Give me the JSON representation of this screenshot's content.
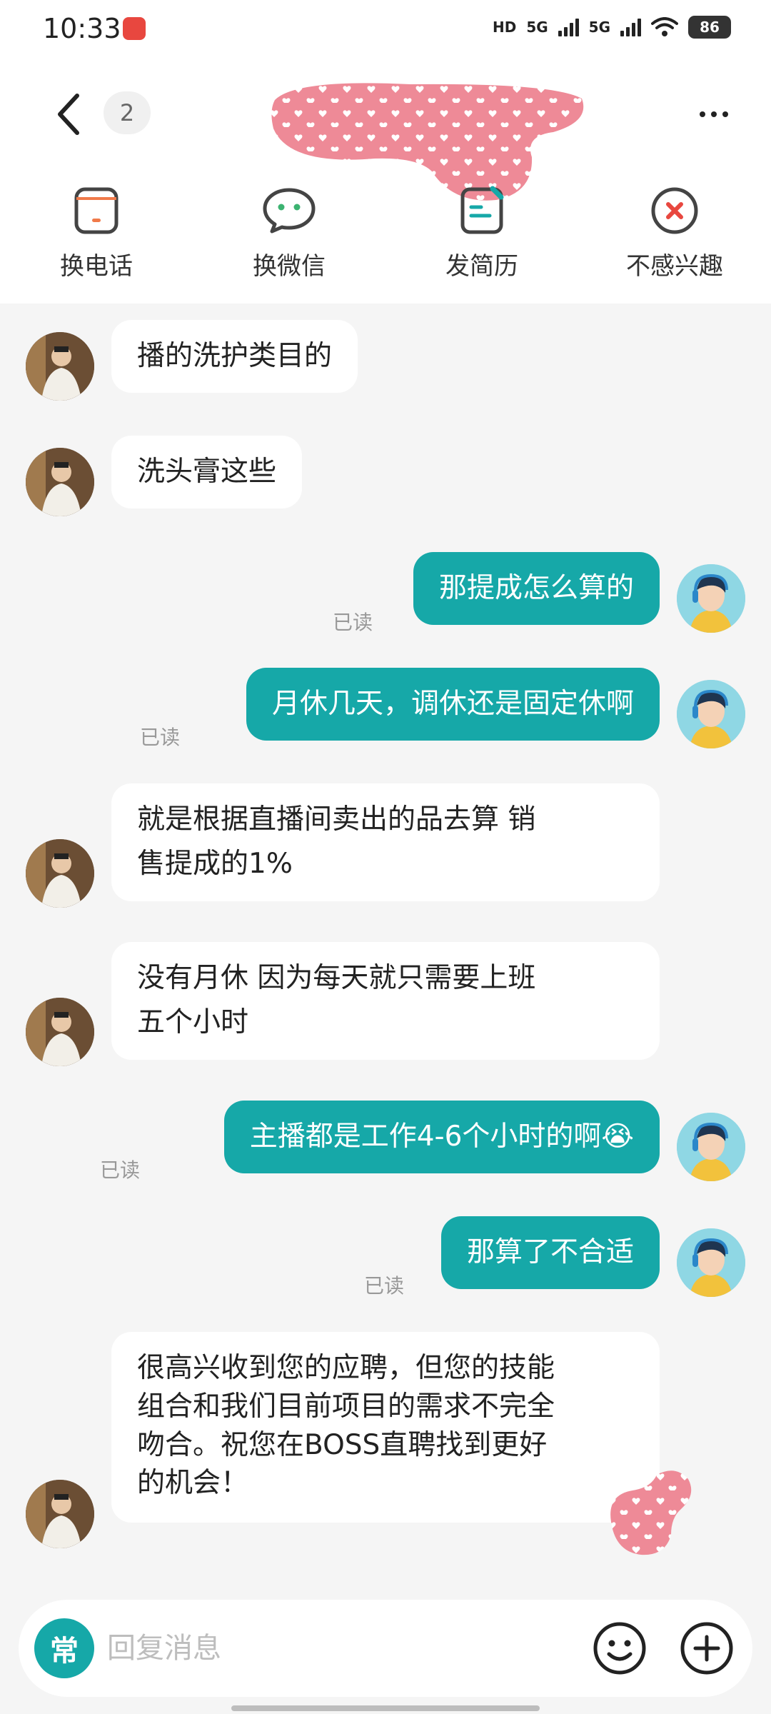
{
  "status_bar": {
    "time": "10:33",
    "hd_label": "HD",
    "net1": "5G",
    "net2": "5G",
    "battery": "86"
  },
  "header": {
    "unread_count": "2",
    "icons": {
      "back": "chevron-left-icon",
      "more": "more-horizontal-icon"
    }
  },
  "actions": [
    {
      "label": "换电话",
      "icon": "phone-icon",
      "color": "#f07a4a"
    },
    {
      "label": "换微信",
      "icon": "wechat-icon",
      "color": "#3cb371"
    },
    {
      "label": "发简历",
      "icon": "resume-icon",
      "color": "#16a8a8"
    },
    {
      "label": "不感兴趣",
      "icon": "close-circle-icon",
      "color": "#e8473f"
    }
  ],
  "messages": [
    {
      "from": "other",
      "text": "播的洗护类目的"
    },
    {
      "from": "other",
      "text": "洗头膏这些"
    },
    {
      "from": "me",
      "text": "那提成怎么算的",
      "status": "已读"
    },
    {
      "from": "me",
      "text": "月休几天，调休还是固定休啊",
      "status": "已读"
    },
    {
      "from": "other",
      "lines": [
        "就是根据直播间卖出的品去算  销",
        "售提成的1%"
      ]
    },
    {
      "from": "other",
      "lines": [
        "没有月休  因为每天就只需要上班",
        "五个小时"
      ]
    },
    {
      "from": "me",
      "text": "主播都是工作4-6个小时的啊",
      "emoji": "😭",
      "status": "已读"
    },
    {
      "from": "me",
      "text": "那算了不合适",
      "status": "已读"
    },
    {
      "from": "other",
      "lines": [
        "很高兴收到您的应聘，但您的技能",
        "组合和我们目前项目的需求不完全",
        "吻合。祝您在BOSS直聘找到更好",
        "的机会！"
      ]
    }
  ],
  "input": {
    "quick_label": "常",
    "placeholder": "回复消息",
    "value": "",
    "icons": {
      "emoji": "emoji-icon",
      "plus": "plus-circle-icon"
    }
  },
  "colors": {
    "accent": "#16a8a8",
    "mask_pink": "#ee8a97",
    "read_status": "#999999"
  }
}
